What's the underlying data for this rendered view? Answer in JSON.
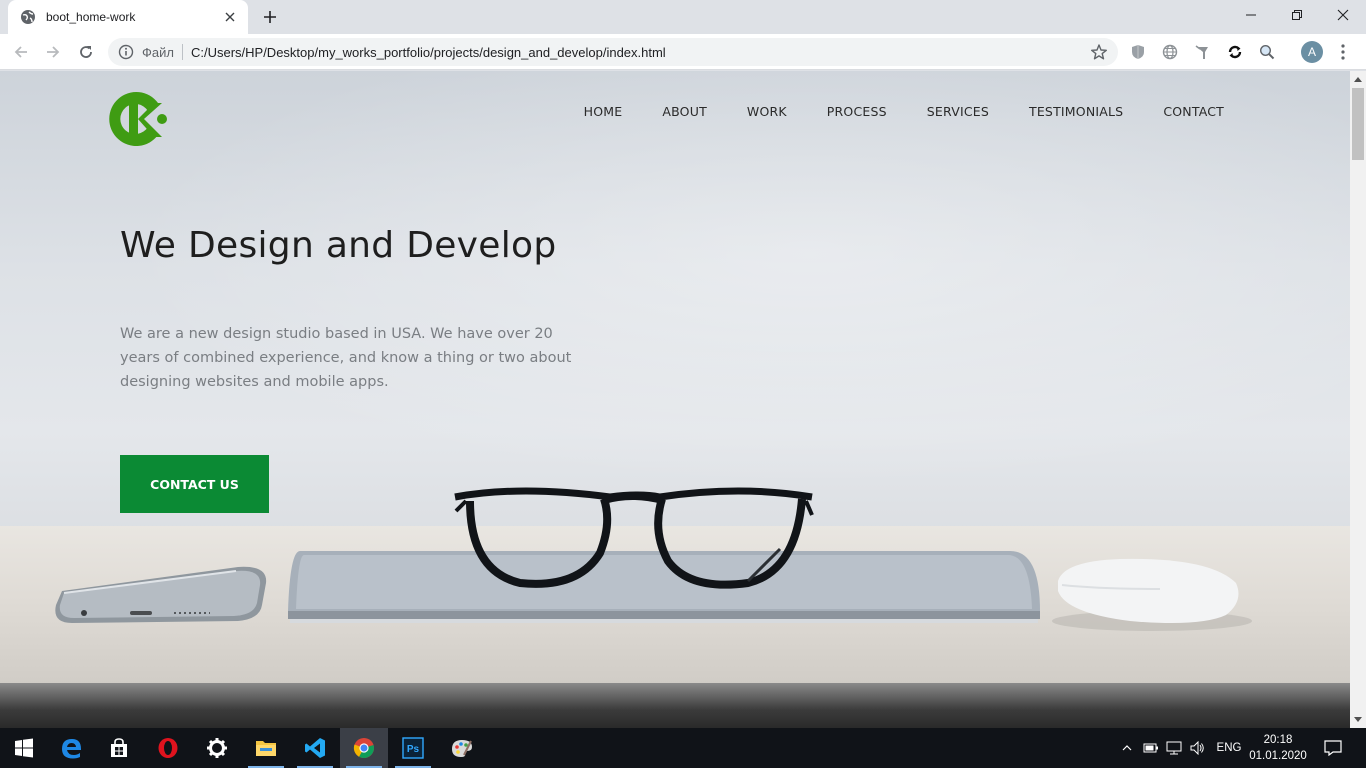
{
  "browser": {
    "tab_title": "boot_home-work",
    "omnibox": {
      "scheme_label": "Файл",
      "url": "C:/Users/HP/Desktop/my_works_portfolio/projects/design_and_develop/index.html"
    },
    "profile_initial": "A"
  },
  "site": {
    "logo_icon": "ck-logo-icon",
    "nav": [
      "HOME",
      "ABOUT",
      "WORK",
      "PROCESS",
      "SERVICES",
      "TESTIMONIALS",
      "CONTACT"
    ],
    "hero": {
      "title": "We Design and Develop",
      "text": "We are a new design studio based in USA. We have over 20 years of combined experience, and know a thing or two about designing websites and mobile apps.",
      "cta_label": "CONTACT US"
    },
    "accent_color": "#0b8a34",
    "logo_color": "#3f9c13"
  },
  "taskbar": {
    "apps": [
      "start",
      "edge",
      "store",
      "opera",
      "settings",
      "explorer",
      "vscode",
      "chrome",
      "photoshop",
      "paint"
    ],
    "language": "ENG",
    "time": "20:18",
    "date": "01.01.2020"
  }
}
